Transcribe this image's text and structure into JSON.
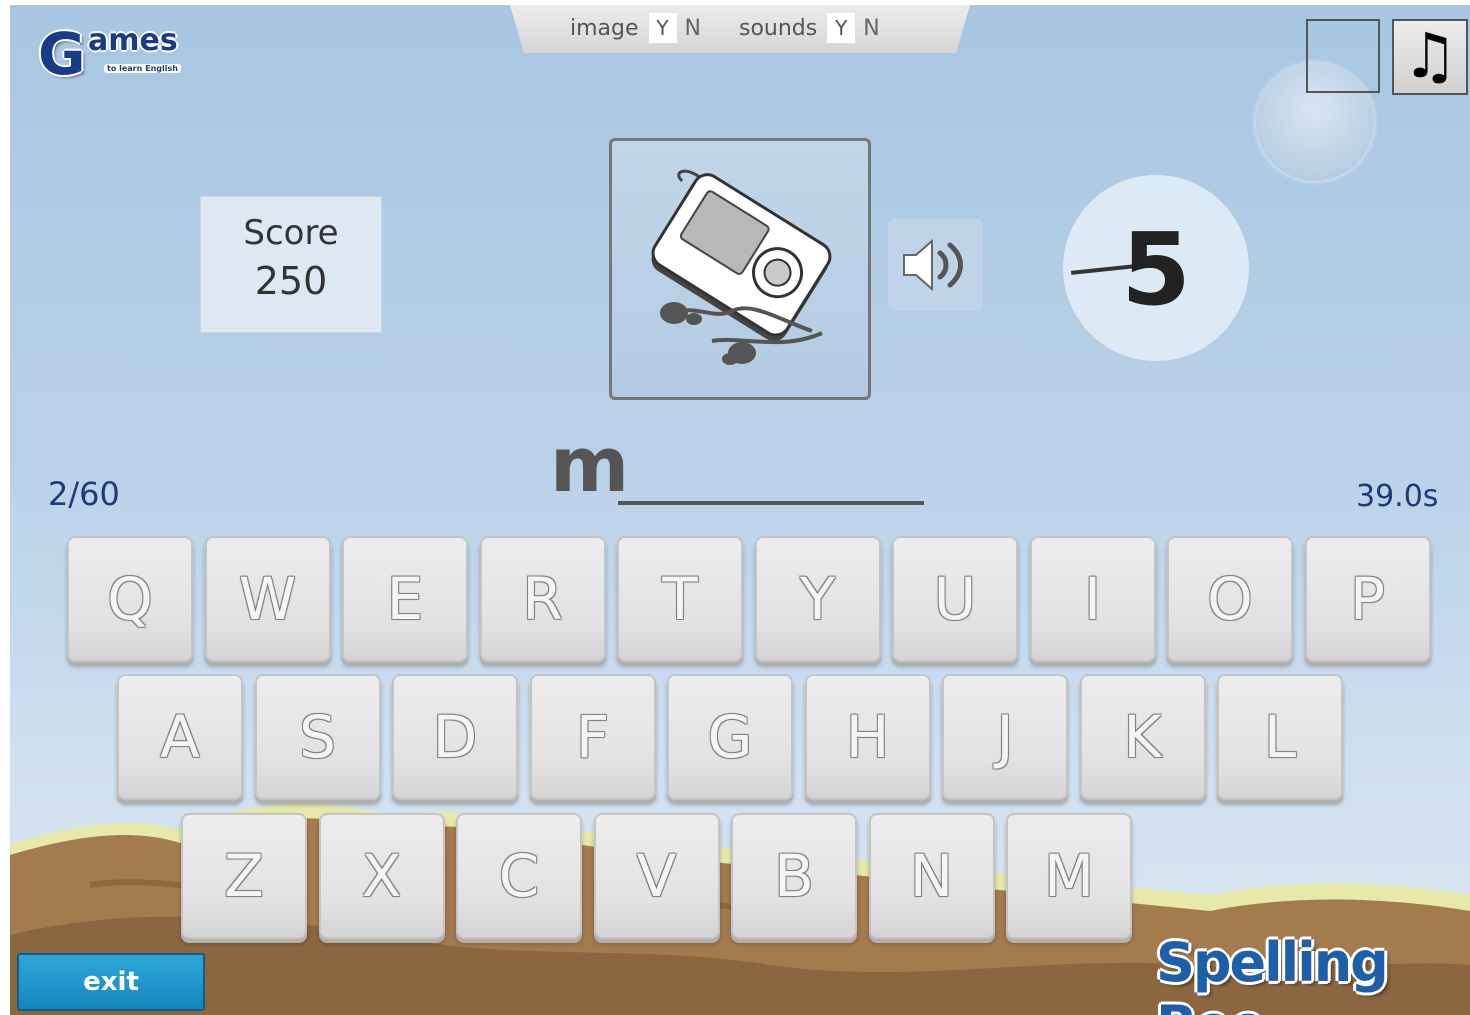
{
  "logo": {
    "big_letter": "G",
    "rest": "ames",
    "tagline": "to learn English"
  },
  "options": {
    "image_label": "image",
    "image_yes": "Y",
    "image_no": "N",
    "sounds_label": "sounds",
    "sounds_yes": "Y",
    "sounds_no": "N"
  },
  "music_icon": "♫",
  "score": {
    "title": "Score",
    "value": "250"
  },
  "picture": {
    "icon": "mp3-player-icon"
  },
  "speaker": {
    "icon": "speaker-icon"
  },
  "timer_circle": {
    "value": "5"
  },
  "word": {
    "typed": "m",
    "remaining_blanks": 9
  },
  "progress": "2/60",
  "time": "39.0s",
  "keyboard": {
    "row1": [
      "Q",
      "W",
      "E",
      "R",
      "T",
      "Y",
      "U",
      "I",
      "O",
      "P"
    ],
    "row2": [
      "A",
      "S",
      "D",
      "F",
      "G",
      "H",
      "J",
      "K",
      "L"
    ],
    "row3": [
      "Z",
      "X",
      "C",
      "V",
      "B",
      "N",
      "M"
    ]
  },
  "exit_label": "exit",
  "brand": "Spelling Bee",
  "colors": {
    "accent": "#1586bf",
    "text_dark_blue": "#1e3a78",
    "sky": "#a8c6e2",
    "ground": "#a07a50"
  }
}
